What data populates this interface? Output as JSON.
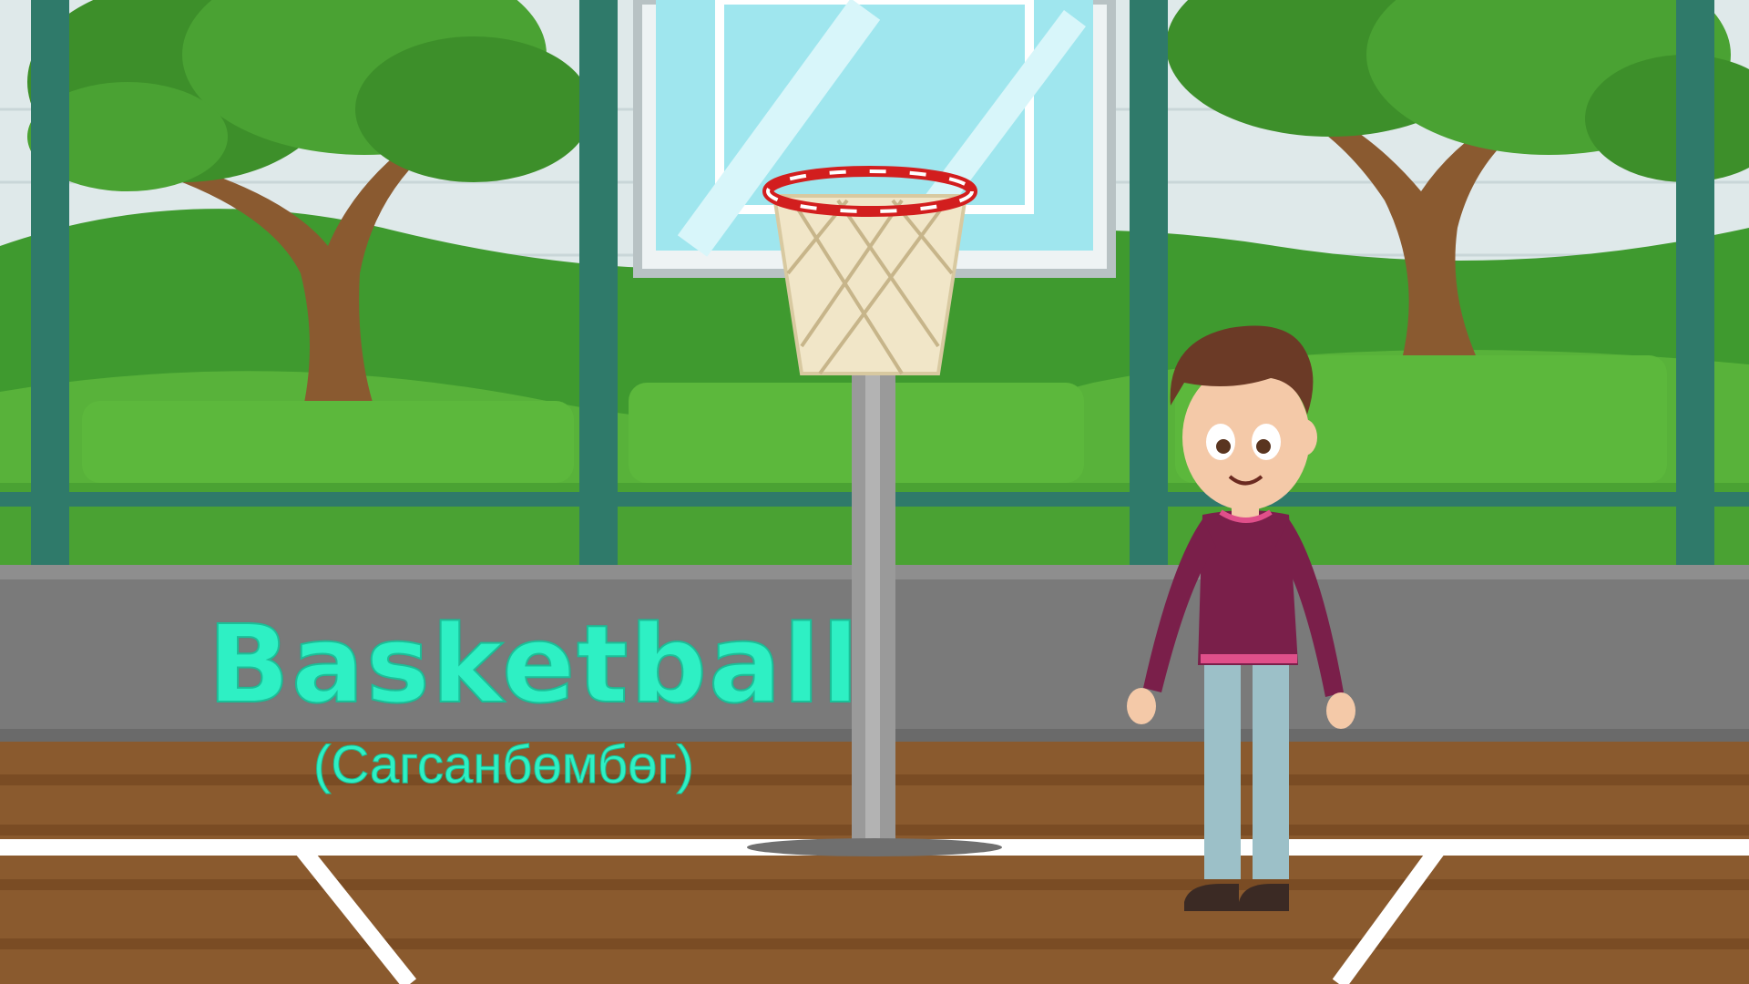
{
  "caption": {
    "word": "Basketball",
    "translation": "(Сагсанбөмбөг)"
  },
  "colors": {
    "caption": "#2ef0c4",
    "court_floor": "#8a5a2e",
    "fence": "#2f7a6a",
    "wall": "#7a7a7a",
    "sky": "#9fe6ee",
    "shirt": "#7a1f4a",
    "pants": "#9cc0c8"
  },
  "scene": {
    "objects": [
      "tree-icon",
      "basketball-hoop-icon",
      "boy-character-icon",
      "fence-icon",
      "court-lines-icon"
    ]
  }
}
